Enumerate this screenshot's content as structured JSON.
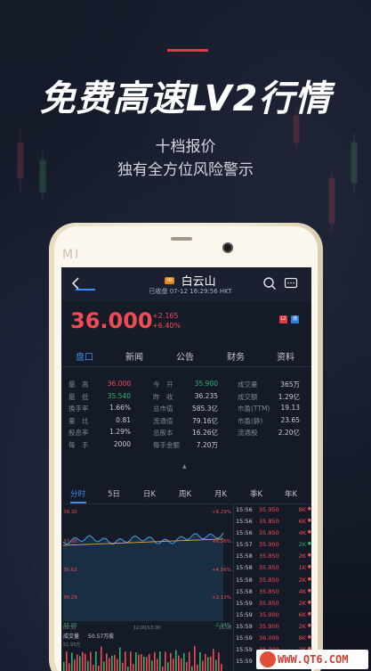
{
  "promo": {
    "headline": "免费高速LV2行情",
    "sub1": "十档报价",
    "sub2": "独有全方位风险警示"
  },
  "phone": {
    "brand": "MI"
  },
  "header": {
    "badge": "HK",
    "stock_name": "白云山",
    "status_line": "已收盘 07-12 16:29:56 HKT"
  },
  "price": {
    "last": "36.000",
    "change": "+2.165",
    "change_pct": "+6.40%",
    "tag_red": "L2",
    "tag_blue": "通",
    "colors": {
      "up": "#ef4b54",
      "down": "#2db36b",
      "accent": "#3e8ef2"
    }
  },
  "tabs": [
    "盘口",
    "新闻",
    "公告",
    "财务",
    "资料"
  ],
  "quote_rows": [
    [
      {
        "l": "最　高",
        "v": "36.000",
        "c": "red"
      },
      {
        "l": "今　开",
        "v": "35.900",
        "c": "green"
      },
      {
        "l": "成交量",
        "v": "365万",
        "c": ""
      }
    ],
    [
      {
        "l": "最　低",
        "v": "35.540",
        "c": "green"
      },
      {
        "l": "昨　收",
        "v": "36.235",
        "c": ""
      },
      {
        "l": "成交额",
        "v": "1.29亿",
        "c": ""
      }
    ],
    [
      {
        "l": "换手率",
        "v": "1.66%",
        "c": ""
      },
      {
        "l": "总市值",
        "v": "585.3亿",
        "c": ""
      },
      {
        "l": "市盈(TTM)",
        "v": "19.13",
        "c": ""
      }
    ],
    [
      {
        "l": "量　比",
        "v": "0.81",
        "c": ""
      },
      {
        "l": "流通值",
        "v": "79.16亿",
        "c": ""
      },
      {
        "l": "市盈(静)",
        "v": "23.65",
        "c": ""
      }
    ],
    [
      {
        "l": "股息率",
        "v": "1.29%",
        "c": ""
      },
      {
        "l": "总股本",
        "v": "16.26亿",
        "c": ""
      },
      {
        "l": "流通股",
        "v": "2.20亿",
        "c": ""
      }
    ],
    [
      {
        "l": "每　手",
        "v": "2000",
        "c": ""
      },
      {
        "l": "每手金额",
        "v": "7.20万",
        "c": ""
      },
      {
        "l": "",
        "v": "",
        "c": ""
      }
    ]
  ],
  "chart_tabs": [
    "分时",
    "5日",
    "日K",
    "周K",
    "月K",
    "季K",
    "年K"
  ],
  "chart": {
    "y_labels_left": [
      "38.30",
      "37.96",
      "36.62",
      "36.29",
      "35.95"
    ],
    "y_labels_right": [
      "+8.29%",
      "+6.56%",
      "+4.56%",
      "+2.13%",
      "-2.94%"
    ],
    "times": [
      "09:30",
      "12:00/13:00",
      "16:08"
    ],
    "volume_label": "成交量",
    "volume_value": "50.57万股",
    "volume_small": "51.93万"
  },
  "trades": [
    {
      "t": "15:56",
      "p": "35.950",
      "v": "8K",
      "c": "red"
    },
    {
      "t": "15:56",
      "p": "35.850",
      "v": "6K",
      "c": "red"
    },
    {
      "t": "15:56",
      "p": "35.850",
      "v": "4K",
      "c": "red"
    },
    {
      "t": "15:57",
      "p": "35.900",
      "v": "2K",
      "c": "green"
    },
    {
      "t": "15:58",
      "p": "35.850",
      "v": "2K",
      "c": "red"
    },
    {
      "t": "15:58",
      "p": "35.850",
      "v": "1K",
      "c": "red"
    },
    {
      "t": "15:58",
      "p": "35.850",
      "v": "2K",
      "c": "red"
    },
    {
      "t": "15:58",
      "p": "35.850",
      "v": "4K",
      "c": "red"
    },
    {
      "t": "15:59",
      "p": "35.850",
      "v": "2K",
      "c": "red"
    },
    {
      "t": "15:59",
      "p": "35.900",
      "v": "6K",
      "c": "red"
    },
    {
      "t": "15:59",
      "p": "35.900",
      "v": "2K",
      "c": "red"
    },
    {
      "t": "15:59",
      "p": "36.000",
      "v": "8K",
      "c": "red"
    },
    {
      "t": "15:59",
      "p": "36.000",
      "v": "2K",
      "c": "red"
    },
    {
      "t": "15:59",
      "p": "36.000",
      "v": "4K",
      "c": "red"
    }
  ],
  "watermark": "WWW.QT6.COM"
}
